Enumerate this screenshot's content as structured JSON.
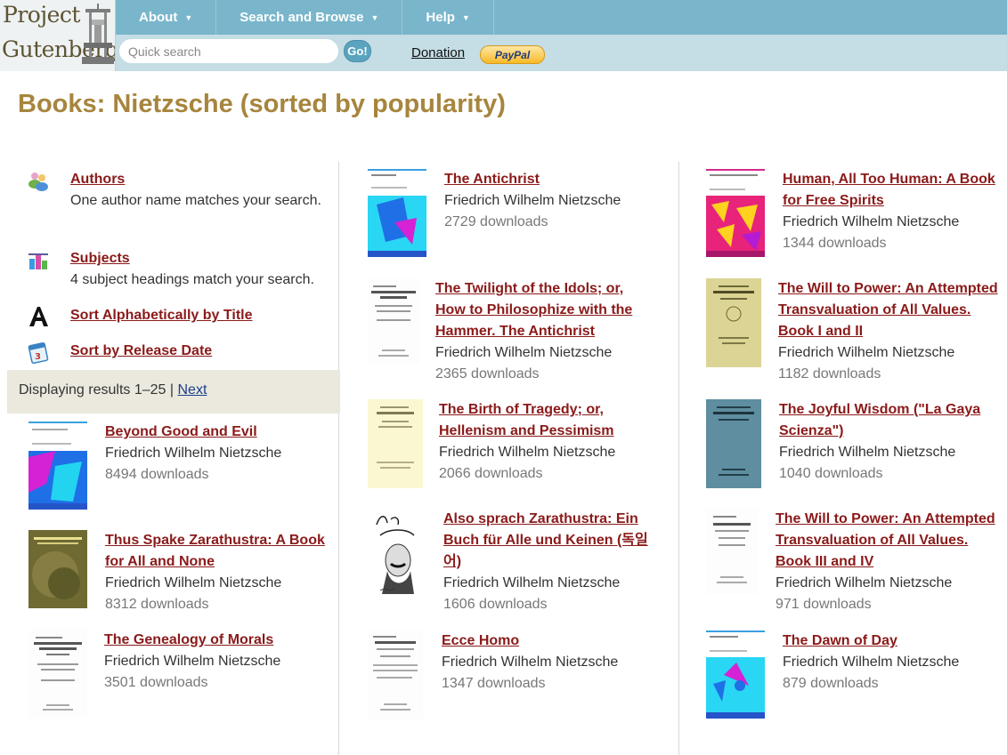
{
  "header": {
    "logo_line1": "Project",
    "logo_line2": "Gutenberg",
    "nav": [
      {
        "label": "About"
      },
      {
        "label": "Search and Browse"
      },
      {
        "label": "Help"
      }
    ],
    "search_placeholder": "Quick search",
    "go_label": "Go!",
    "donation_label": "Donation",
    "paypal_label": "PayPal"
  },
  "page_title": "Books: Nietzsche (sorted by popularity)",
  "sidebar": {
    "authors_label": "Authors",
    "authors_desc": "One author name matches your search.",
    "subjects_label": "Subjects",
    "subjects_desc": "4 subject headings match your search.",
    "sort_title_label": "Sort Alphabetically by Title",
    "sort_date_label": "Sort by Release Date",
    "results_text": "Displaying results 1–25 |",
    "next_label": "Next"
  },
  "colors": {
    "accent_title": "#a7853d",
    "link": "#8b1a1a",
    "topbar": "#7ab6cb",
    "subbar": "#c5dde5"
  },
  "books": [
    {
      "title": "Beyond Good and Evil",
      "author": "Friedrich Wilhelm Nietzsche",
      "downloads": "8494 downloads"
    },
    {
      "title": "Thus Spake Zarathustra: A Book for All and None",
      "author": "Friedrich Wilhelm Nietzsche",
      "downloads": "8312 downloads"
    },
    {
      "title": "The Genealogy of Morals",
      "author": "Friedrich Wilhelm Nietzsche",
      "downloads": "3501 downloads"
    },
    {
      "title": "The Antichrist",
      "author": "Friedrich Wilhelm Nietzsche",
      "downloads": "2729 downloads"
    },
    {
      "title": "The Twilight of the Idols; or, How to Philosophize with the Hammer. The Antichrist",
      "author": "Friedrich Wilhelm Nietzsche",
      "downloads": "2365 downloads"
    },
    {
      "title": "The Birth of Tragedy; or, Hellenism and Pessimism",
      "author": "Friedrich Wilhelm Nietzsche",
      "downloads": "2066 downloads"
    },
    {
      "title": "Also sprach Zarathustra: Ein Buch für Alle und Keinen (독일어)",
      "author": "Friedrich Wilhelm Nietzsche",
      "downloads": "1606 downloads"
    },
    {
      "title": "Ecce Homo",
      "author": "Friedrich Wilhelm Nietzsche",
      "downloads": "1347 downloads"
    },
    {
      "title": "Human, All Too Human: A Book for Free Spirits",
      "author": "Friedrich Wilhelm Nietzsche",
      "downloads": "1344 downloads"
    },
    {
      "title": "The Will to Power: An Attempted Transvaluation of All Values. Book I and II",
      "author": "Friedrich Wilhelm Nietzsche",
      "downloads": "1182 downloads"
    },
    {
      "title": "The Joyful Wisdom (\"La Gaya Scienza\")",
      "author": "Friedrich Wilhelm Nietzsche",
      "downloads": "1040 downloads"
    },
    {
      "title": "The Will to Power: An Attempted Transvaluation of All Values. Book III and IV",
      "author": "Friedrich Wilhelm Nietzsche",
      "downloads": "971 downloads"
    },
    {
      "title": "The Dawn of Day",
      "author": "Friedrich Wilhelm Nietzsche",
      "downloads": "879 downloads"
    }
  ]
}
